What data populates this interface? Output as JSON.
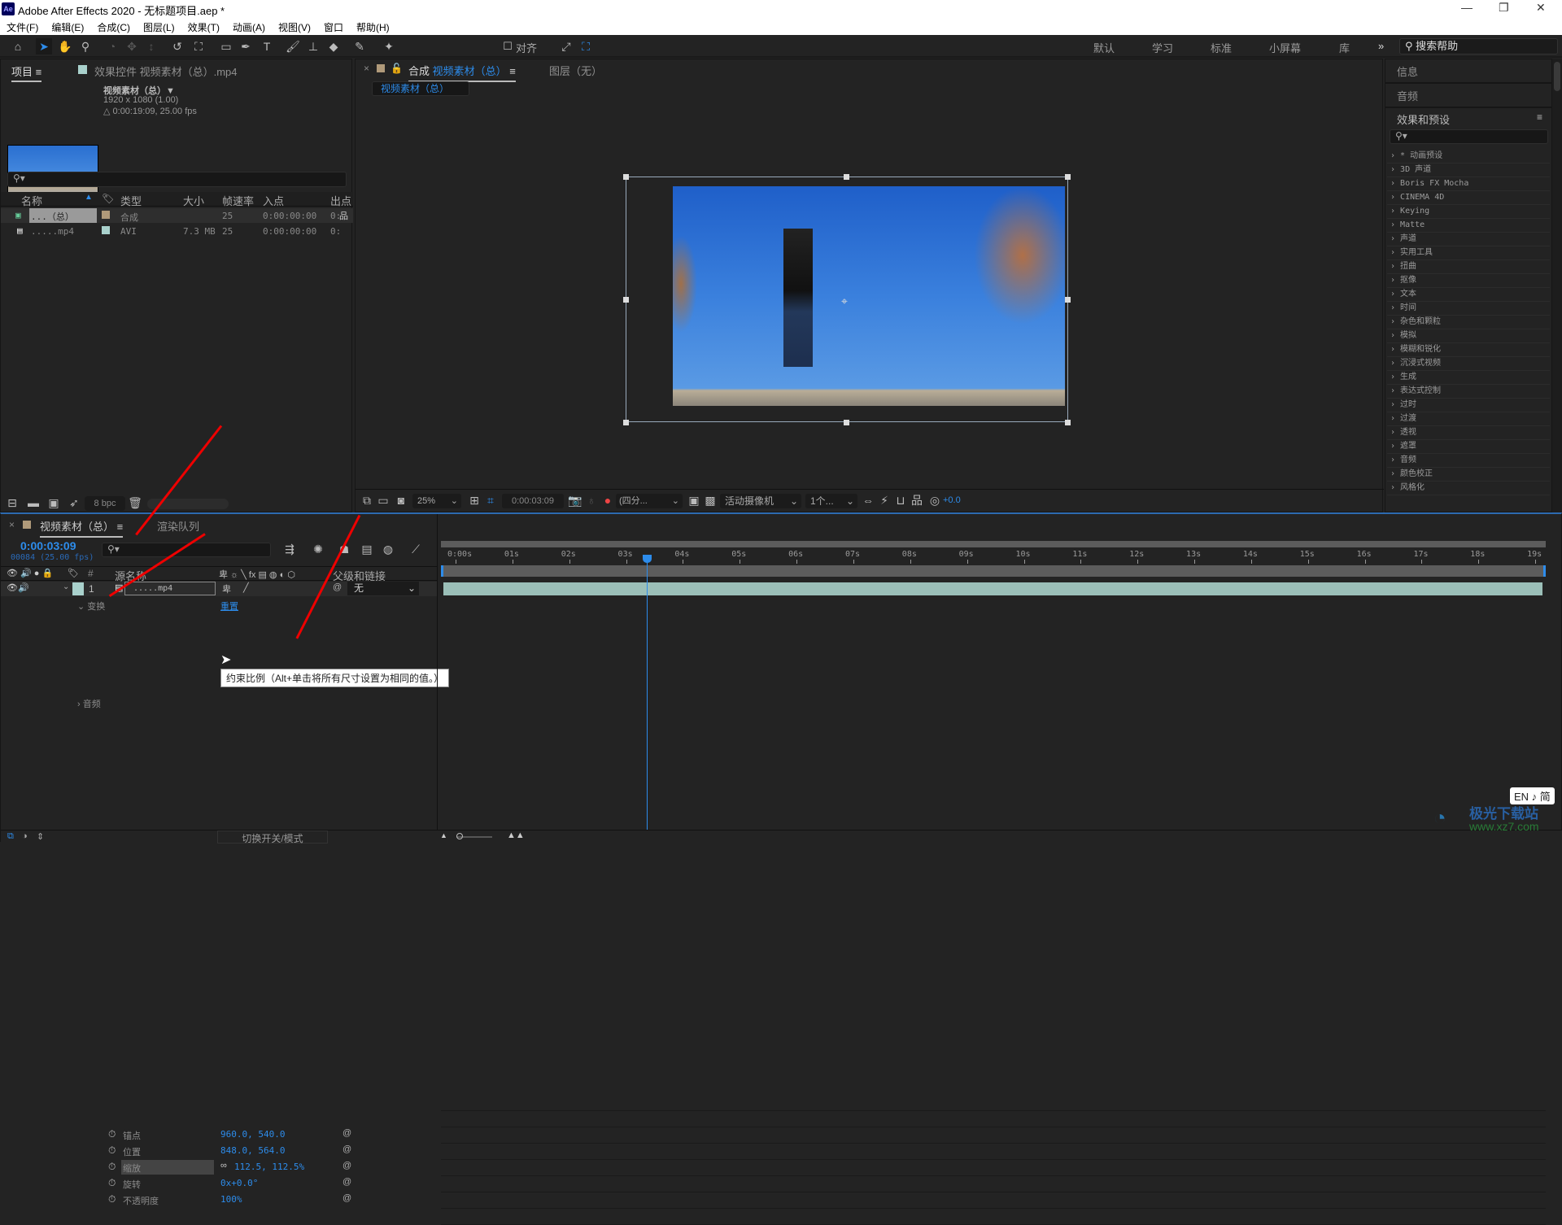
{
  "window": {
    "title": "Adobe After Effects 2020 - 无标题项目.aep *",
    "logo": "Ae"
  },
  "menu": [
    "文件(F)",
    "编辑(E)",
    "合成(C)",
    "图层(L)",
    "效果(T)",
    "动画(A)",
    "视图(V)",
    "窗口",
    "帮助(H)"
  ],
  "toolbar": {
    "snap_label": "对齐",
    "workspaces": [
      "默认",
      "学习",
      "标准",
      "小屏幕",
      "库"
    ],
    "more": "»",
    "search_help": "搜索帮助"
  },
  "project": {
    "tab_label": "项目",
    "effects_tab_label": "效果控件 视频素材（总）.mp4",
    "item_name": "视频素材（总）▼",
    "item_res": "1920 x 1080 (1.00)",
    "item_dur": "△ 0:00:19:09, 25.00 fps",
    "columns": [
      "名称",
      "类型",
      "大小",
      "帧速率",
      "入点",
      "出点"
    ],
    "rows": [
      {
        "name": "...（总）",
        "type": "合成",
        "size": "",
        "fps": "25",
        "in": "0:00:00:00",
        "out": "0:",
        "label_color": "#b09a7a"
      },
      {
        "name": ".....mp4",
        "type": "AVI",
        "size": "7.3 MB",
        "fps": "25",
        "in": "0:00:00:00",
        "out": "0:",
        "label_color": "#a9d1cc"
      }
    ],
    "bpc": "8 bpc"
  },
  "composition": {
    "tab_prefix": "合成",
    "tab_name": "视频素材（总）",
    "layer_tab": "图层（无）",
    "breadcrumb": "视频素材（总）",
    "zoom": "25%",
    "timecode": "0:00:03:09",
    "resolution": "(四分...",
    "camera": "活动摄像机",
    "views": "1个...",
    "exposure": "+0.0"
  },
  "right_panel": {
    "info": "信息",
    "audio": "音频",
    "effects_title": "效果和预设",
    "effects": [
      "* 动画预设",
      "3D 声道",
      "Boris FX Mocha",
      "CINEMA 4D",
      "Keying",
      "Matte",
      "声道",
      "实用工具",
      "扭曲",
      "抠像",
      "文本",
      "时间",
      "杂色和颗粒",
      "模拟",
      "模糊和锐化",
      "沉浸式视频",
      "生成",
      "表达式控制",
      "过时",
      "过渡",
      "透视",
      "遮罩",
      "音频",
      "颜色校正",
      "风格化"
    ]
  },
  "timeline": {
    "tab_name": "视频素材（总）",
    "render_queue": "渲染队列",
    "timecode": "0:00:03:09",
    "frame_info": "00084 (25.00 fps)",
    "col_source": "源名称",
    "col_parent": "父级和链接",
    "layer": {
      "index": "1",
      "name": ".....mp4",
      "parent": "无",
      "color": "#a9d1cc"
    },
    "transform_label": "变换",
    "reset_label": "重置",
    "properties": [
      {
        "name": "锚点",
        "value": "960.0, 540.0"
      },
      {
        "name": "位置",
        "value": "848.0, 564.0"
      },
      {
        "name": "缩放",
        "value": "112.5, 112.5%"
      },
      {
        "name": "旋转",
        "value": "0x+0.0°"
      },
      {
        "name": "不透明度",
        "value": "100%"
      }
    ],
    "audio_label": "音频",
    "tooltip": "约束比例（Alt+单击将所有尺寸设置为相同的值。）",
    "ruler_ticks": [
      "0:00s",
      "01s",
      "02s",
      "03s",
      "04s",
      "05s",
      "06s",
      "07s",
      "08s",
      "09s",
      "10s",
      "11s",
      "12s",
      "13s",
      "14s",
      "15s",
      "16s",
      "17s",
      "18s",
      "19s"
    ],
    "playhead_seconds": 3.36,
    "duration_seconds": 19.36,
    "toggle_label": "切换开关/模式"
  },
  "ime": "EN ♪ 简",
  "watermark": {
    "name": "极光下载站",
    "url": "www.xz7.com"
  }
}
